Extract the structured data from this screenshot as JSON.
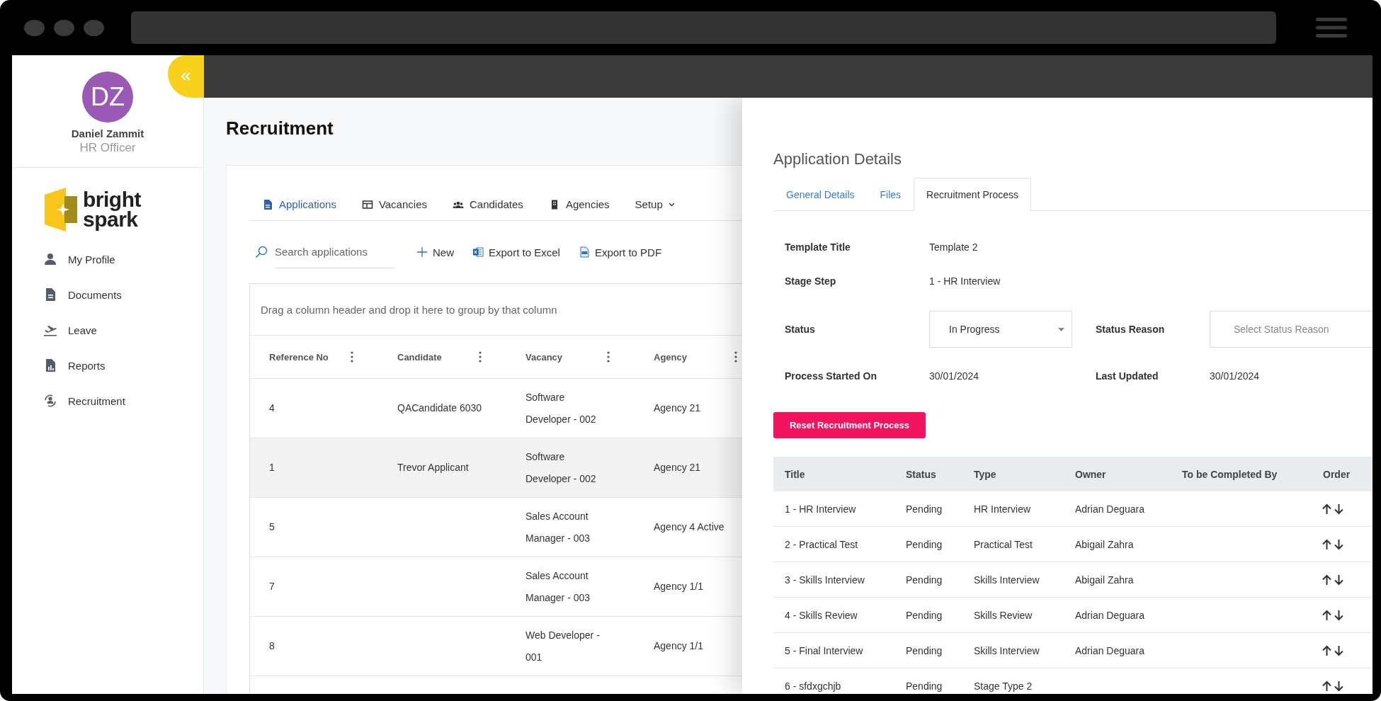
{
  "user": {
    "initials": "DZ",
    "name": "Daniel Zammit",
    "role": "HR Officer"
  },
  "logo": {
    "text": "bright spark"
  },
  "nav": [
    {
      "label": "My Profile"
    },
    {
      "label": "Documents"
    },
    {
      "label": "Leave"
    },
    {
      "label": "Reports"
    },
    {
      "label": "Recruitment"
    }
  ],
  "page_title": "Recruitment",
  "tabs": [
    {
      "label": "Applications",
      "kind": "tab",
      "selected": true
    },
    {
      "label": "Vacancies",
      "kind": "tab",
      "selected": false
    },
    {
      "label": "Candidates",
      "kind": "tab",
      "selected": false
    },
    {
      "label": "Agencies",
      "kind": "tab",
      "selected": false
    },
    {
      "label": "Setup",
      "kind": "dropdown",
      "selected": false
    }
  ],
  "search": {
    "placeholder": "Search applications"
  },
  "actions": [
    "New",
    "Export to Excel",
    "Export to PDF"
  ],
  "group_hint": "Drag a column header and drop it here to group by that column",
  "grid": {
    "columns": [
      "Reference No",
      "Candidate",
      "Vacancy",
      "Agency"
    ],
    "rows": [
      {
        "selected": false,
        "ref": "4",
        "candidate": "QACandidate 6030",
        "vacancy": "Software Developer - 002",
        "agency": "Agency 21"
      },
      {
        "selected": true,
        "ref": "1",
        "candidate": "Trevor Applicant",
        "vacancy": "Software Developer - 002",
        "agency": "Agency 21"
      },
      {
        "selected": false,
        "ref": "5",
        "vacancy": "Sales Account Manager - 003",
        "agency": "Agency 4 Active"
      },
      {
        "selected": false,
        "ref": "7",
        "vacancy": "Sales Account Manager - 003",
        "agency": "Agency 1/1"
      },
      {
        "selected": false,
        "ref": "8",
        "vacancy": "Web Developer - 001",
        "agency": "Agency 1/1"
      }
    ]
  },
  "details_panel": {
    "title": "Application Details",
    "tabs": [
      {
        "label": "General Details",
        "selected": false
      },
      {
        "label": "Files",
        "selected": false
      },
      {
        "label": "Recruitment Process",
        "selected": true
      }
    ],
    "field_rows": [
      [
        {
          "label": "Template Title",
          "kind": "text",
          "value": "Template 2"
        }
      ],
      [
        {
          "label": "Stage Step",
          "kind": "text",
          "value": "1 - HR Interview"
        }
      ],
      [
        {
          "label": "Status",
          "kind": "select",
          "value": "In Progress"
        },
        {
          "label": "Status Reason",
          "kind": "select",
          "placeholder": "Select Status Reason"
        }
      ],
      [
        {
          "label": "Process Started On",
          "kind": "text",
          "value": "30/01/2024"
        },
        {
          "label": "Last Updated",
          "kind": "text",
          "value": "30/01/2024"
        }
      ]
    ],
    "reset_button": "Reset Recruitment Process",
    "stages": {
      "columns": [
        "Title",
        "Status",
        "Type",
        "Owner",
        "To be Completed By",
        "Order"
      ],
      "rows": [
        {
          "title": "1 - HR Interview",
          "status": "Pending",
          "type": "HR Interview",
          "owner": "Adrian Deguara"
        },
        {
          "title": "2 - Practical Test",
          "status": "Pending",
          "type": "Practical Test",
          "owner": "Abigail Zahra"
        },
        {
          "title": "3 - Skills Interview",
          "status": "Pending",
          "type": "Skills Interview",
          "owner": "Abigail Zahra"
        },
        {
          "title": "4 - Skills Review",
          "status": "Pending",
          "type": "Skills Review",
          "owner": "Adrian Deguara"
        },
        {
          "title": "5 - Final Interview",
          "status": "Pending",
          "type": "Skills Interview",
          "owner": "Adrian Deguara"
        },
        {
          "title": "6 - sfdxgchjb",
          "status": "Pending",
          "type": "Stage Type 2"
        }
      ]
    }
  }
}
